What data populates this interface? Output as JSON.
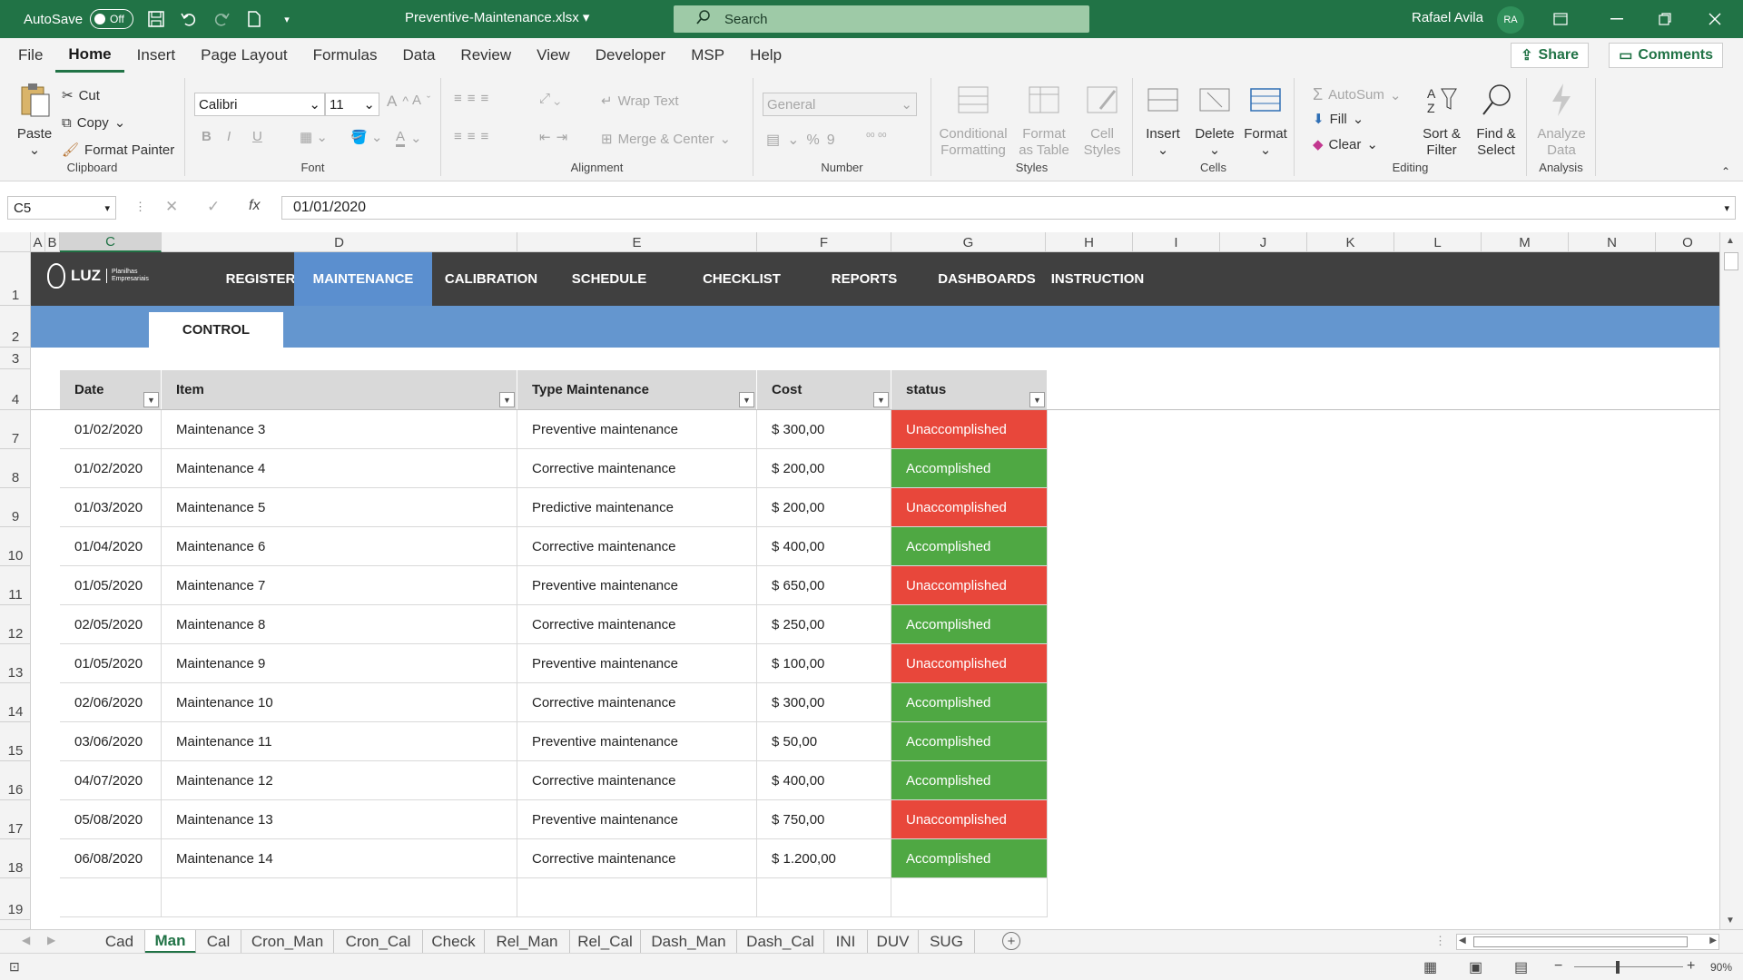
{
  "titlebar": {
    "autosave_label": "AutoSave",
    "autosave_state": "Off",
    "filename": "Preventive-Maintenance.xlsx",
    "search_placeholder": "Search",
    "user_name": "Rafael Avila",
    "user_initials": "RA"
  },
  "menu": {
    "items": [
      "File",
      "Home",
      "Insert",
      "Page Layout",
      "Formulas",
      "Data",
      "Review",
      "View",
      "Developer",
      "MSP",
      "Help"
    ],
    "active": "Home",
    "share_label": "Share",
    "comments_label": "Comments"
  },
  "ribbon": {
    "clipboard": {
      "paste": "Paste",
      "cut": "Cut",
      "copy": "Copy",
      "format_painter": "Format Painter",
      "label": "Clipboard"
    },
    "font": {
      "name": "Calibri",
      "size": "11",
      "label": "Font",
      "bold": "B",
      "italic": "I",
      "underline": "U"
    },
    "alignment": {
      "wrap_text": "Wrap Text",
      "merge_center": "Merge & Center",
      "label": "Alignment"
    },
    "number": {
      "format": "General",
      "label": "Number"
    },
    "styles": {
      "conditional_formatting": "Conditional Formatting",
      "format_as_table": "Format as Table",
      "cell_styles": "Cell Styles",
      "label": "Styles"
    },
    "cells": {
      "insert": "Insert",
      "delete": "Delete",
      "format": "Format",
      "label": "Cells"
    },
    "editing": {
      "autosum": "AutoSum",
      "fill": "Fill",
      "clear": "Clear",
      "sort_filter": "Sort & Filter",
      "find_select": "Find & Select",
      "label": "Editing"
    },
    "analysis": {
      "analyze_data": "Analyze Data",
      "label": "Analysis"
    }
  },
  "formula_bar": {
    "name_box": "C5",
    "formula": "01/01/2020",
    "fx": "fx"
  },
  "columns": [
    "A",
    "B",
    "C",
    "D",
    "E",
    "F",
    "G",
    "H",
    "I",
    "J",
    "K",
    "L",
    "M",
    "N",
    "O"
  ],
  "selected_column": "C",
  "rows": [
    "1",
    "2",
    "3",
    "4",
    "7",
    "8",
    "9",
    "10",
    "11",
    "12",
    "13",
    "14",
    "15",
    "16",
    "17",
    "18",
    "19"
  ],
  "nav": {
    "logo_text": "LUZ",
    "logo_sub": "Planilhas Empresariais",
    "tabs": [
      "REGISTER",
      "MAINTENANCE",
      "CALIBRATION",
      "SCHEDULE",
      "CHECKLIST",
      "REPORTS",
      "DASHBOARDS",
      "INSTRUCTION"
    ],
    "active": "MAINTENANCE",
    "subtab": "CONTROL"
  },
  "table": {
    "headers": [
      "Date",
      "Item",
      "Type Maintenance",
      "Cost",
      "status"
    ],
    "rows": [
      [
        "01/02/2020",
        "Maintenance 3",
        "Preventive maintenance",
        "$ 300,00",
        "Unaccomplished"
      ],
      [
        "01/02/2020",
        "Maintenance 4",
        "Corrective maintenance",
        "$ 200,00",
        "Accomplished"
      ],
      [
        "01/03/2020",
        "Maintenance 5",
        "Predictive maintenance",
        "$ 200,00",
        "Unaccomplished"
      ],
      [
        "01/04/2020",
        "Maintenance 6",
        "Corrective maintenance",
        "$ 400,00",
        "Accomplished"
      ],
      [
        "01/05/2020",
        "Maintenance 7",
        "Preventive maintenance",
        "$ 650,00",
        "Unaccomplished"
      ],
      [
        "02/05/2020",
        "Maintenance 8",
        "Corrective maintenance",
        "$ 250,00",
        "Accomplished"
      ],
      [
        "01/05/2020",
        "Maintenance 9",
        "Preventive maintenance",
        "$ 100,00",
        "Unaccomplished"
      ],
      [
        "02/06/2020",
        "Maintenance 10",
        "Corrective maintenance",
        "$ 300,00",
        "Accomplished"
      ],
      [
        "03/06/2020",
        "Maintenance 11",
        "Preventive maintenance",
        "$ 50,00",
        "Accomplished"
      ],
      [
        "04/07/2020",
        "Maintenance 12",
        "Corrective maintenance",
        "$ 400,00",
        "Accomplished"
      ],
      [
        "05/08/2020",
        "Maintenance 13",
        "Preventive maintenance",
        "$ 750,00",
        "Unaccomplished"
      ],
      [
        "06/08/2020",
        "Maintenance 14",
        "Corrective maintenance",
        "$ 1.200,00",
        "Accomplished"
      ]
    ]
  },
  "sheet_tabs": [
    "Cad",
    "Man",
    "Cal",
    "Cron_Man",
    "Cron_Cal",
    "Check",
    "Rel_Man",
    "Rel_Cal",
    "Dash_Man",
    "Dash_Cal",
    "INI",
    "DUV",
    "SUG"
  ],
  "active_sheet": "Man",
  "status": {
    "zoom": "90%"
  },
  "colors": {
    "excel_green": "#217346",
    "accomplished": "#4fa843",
    "unaccomplished": "#e8473b",
    "nav_dark": "#404040",
    "nav_blue": "#6496cf"
  }
}
